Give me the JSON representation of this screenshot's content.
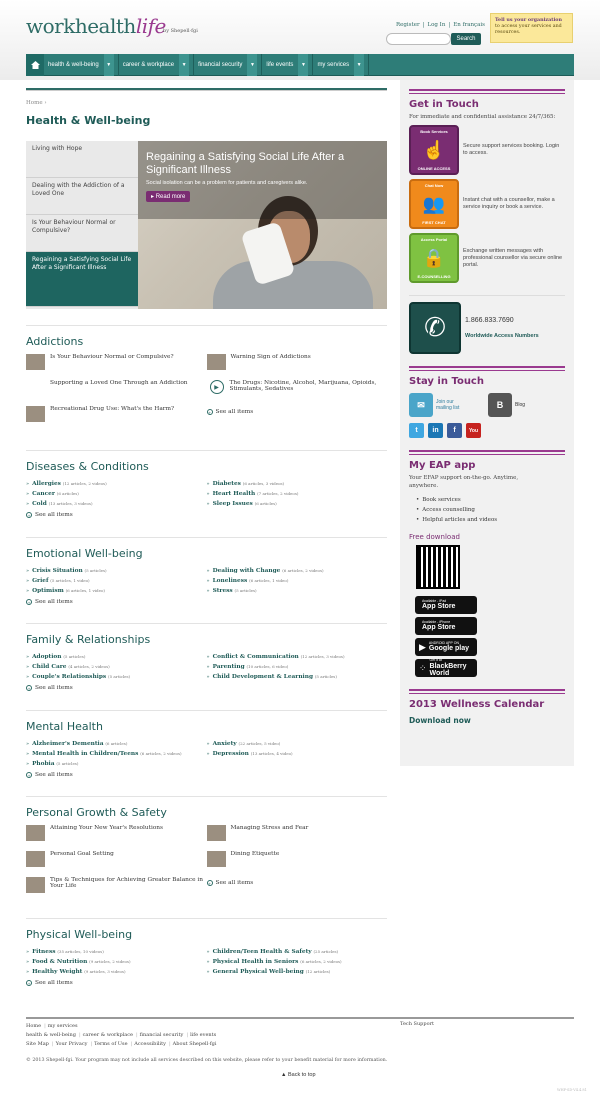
{
  "header": {
    "logo_work": "work",
    "logo_health": "health",
    "logo_life": "life",
    "byline": "by Shepell·fgi",
    "links": [
      "Register",
      "Log In",
      "En français"
    ],
    "search_button": "Search",
    "tell_us_bold": "Tell us your organization",
    "tell_us_text": "to access your services and resources."
  },
  "nav": {
    "items": [
      "health & well-being",
      "career & workplace",
      "financial security",
      "life events",
      "my services"
    ]
  },
  "breadcrumb": "Home",
  "page_title": "Health & Well-being",
  "featured": {
    "tabs": [
      "Living with Hope",
      "Dealing with the Addiction of a Loved One",
      "Is Your Behaviour Normal or Compulsive?",
      "Regaining a Satisfying Social Life After a Significant Illness"
    ],
    "title": "Regaining a Satisfying Social Life After a Significant Illness",
    "desc": "Social isolation can be a problem for patients and caregivers alike.",
    "read_more": "Read more"
  },
  "addictions": {
    "title": "Addictions",
    "left": [
      "Is Your Behaviour Normal or Compulsive?",
      "Supporting a Loved One Through an Addiction",
      "Recreational Drug Use: What's the Harm?"
    ],
    "right": [
      "Warning Sign of Addictions",
      "The Drugs: Nicotine, Alcohol, Marijuana, Opioids, Stimulants, Sedatives"
    ],
    "see_all": "See all items"
  },
  "diseases": {
    "title": "Diseases & Conditions",
    "left": [
      [
        "Allergies",
        "(12 articles, 2 videos)"
      ],
      [
        "Cancer",
        "(6 articles)"
      ],
      [
        "Cold",
        "(13 articles, 3 videos)"
      ]
    ],
    "right": [
      [
        "Diabetes",
        "(6 articles, 3 videos)"
      ],
      [
        "Heart Health",
        "(7 articles, 2 videos)"
      ],
      [
        "Sleep Issues",
        "(6 articles)"
      ]
    ],
    "see_all": "See all items"
  },
  "emotional": {
    "title": "Emotional Well-being",
    "left": [
      [
        "Crisis Situation",
        "(5 articles)"
      ],
      [
        "Grief",
        "(5 articles, 1 video)"
      ],
      [
        "Optimism",
        "(6 articles, 1 video)"
      ]
    ],
    "right": [
      [
        "Dealing with Change",
        "(6 articles, 2 videos)"
      ],
      [
        "Loneliness",
        "(6 articles, 1 video)"
      ],
      [
        "Stress",
        "(5 articles)"
      ]
    ],
    "see_all": "See all items"
  },
  "family": {
    "title": "Family & Relationships",
    "left": [
      [
        "Adoption",
        "(5 articles)"
      ],
      [
        "Child Care",
        "(4 articles, 2 videos)"
      ],
      [
        "Couple's Relationships",
        "(5 articles)"
      ]
    ],
    "right": [
      [
        "Conflict & Communication",
        "(12 articles, 3 videos)"
      ],
      [
        "Parenting",
        "(10 articles, 6 video)"
      ],
      [
        "Child Development & Learning",
        "(5 articles)"
      ]
    ],
    "see_all": "See all items"
  },
  "mental": {
    "title": "Mental Health",
    "left": [
      [
        "Alzheimer's Dementia",
        "(6 articles)"
      ],
      [
        "Mental Health in Children/Teens",
        "(6 articles, 2 videos)"
      ],
      [
        "Phobia",
        "(5 articles)"
      ]
    ],
    "right": [
      [
        "Anxiety",
        "(22 articles, 5 video)"
      ],
      [
        "Depression",
        "(13 articles, 4 video)"
      ]
    ],
    "see_all": "See all items"
  },
  "personal": {
    "title": "Personal Growth & Safety",
    "left": [
      "Attaining Your New Year's Resolutions",
      "Personal Goal Setting",
      "Tips & Techniques for Achieving Greater Balance in Your Life"
    ],
    "right": [
      "Managing Stress and Fear",
      "Dining Etiquette"
    ],
    "see_all": "See all items"
  },
  "physical": {
    "title": "Physical Well-being",
    "left": [
      [
        "Fitness",
        "(35 articles, 10 videos)"
      ],
      [
        "Food & Nutrition",
        "(9 articles, 2 videos)"
      ],
      [
        "Healthy Weight",
        "(9 articles, 3 videos)"
      ]
    ],
    "right": [
      [
        "Children/Teen Health & Safety",
        "(25 articles)"
      ],
      [
        "Physical Health in Seniors",
        "(6 articles, 2 videos)"
      ],
      [
        "General Physical Well-being",
        "(12 articles)"
      ]
    ],
    "see_all": "See all items"
  },
  "sidebar": {
    "get_in_touch": "Get in Touch",
    "git_text": "For immediate and confidential assistance 24/7/365:",
    "services": [
      {
        "top": "Book Services",
        "bottom": "ONLINE ACCESS",
        "text": "Secure support services booking. Login to access.",
        "color": "#7a2d72"
      },
      {
        "top": "Chat Now",
        "bottom": "FIRST CHAT",
        "text": "Instant chat with a counsellor, make a service inquiry or book a service.",
        "color": "#f08a1c"
      },
      {
        "top": "Access Portal",
        "bottom": "E-COUNSELLING",
        "text": "Exchange written messages with professional counsellor via secure online portal.",
        "color": "#7fc242"
      }
    ],
    "phone": "1.866.833.7690",
    "phone_label": "Worldwide Access Numbers",
    "stay_in_touch": "Stay in Touch",
    "mailing": "Join our mailing list",
    "blog": "Blog",
    "eap_title": "My EAP app",
    "eap_text": "Your EFAP support on-the-go. Anytime, anywhere.",
    "eap_bullets": [
      "Book services",
      "Access counselling",
      "Helpful articles and videos"
    ],
    "free_download": "Free download",
    "badges": [
      {
        "small": "Available - iPad",
        "big": "App Store"
      },
      {
        "small": "Available - iPhone",
        "big": "App Store"
      },
      {
        "small": "ANDROID APP ON",
        "big": "Google play"
      },
      {
        "small": "Get it at",
        "big": "BlackBerry World"
      }
    ],
    "calendar_title": "2013 Wellness Calendar",
    "download_now": "Download now"
  },
  "footer": {
    "row1": [
      "Home",
      "my services"
    ],
    "row2": [
      "health & well-being",
      "career & workplace",
      "financial security",
      "life events"
    ],
    "row3": [
      "Site Map",
      "Your Privacy",
      "Terms of Use",
      "Accessibility",
      "About Shepell·fgi"
    ],
    "tech": "Tech Support",
    "copy": "© 2013 Shepell·fgi. Your program may not include all services described on this website, please refer to your benefit material for more information.",
    "back_to_top": "Back to top",
    "version": "WHP-SD-V4.4.81"
  }
}
